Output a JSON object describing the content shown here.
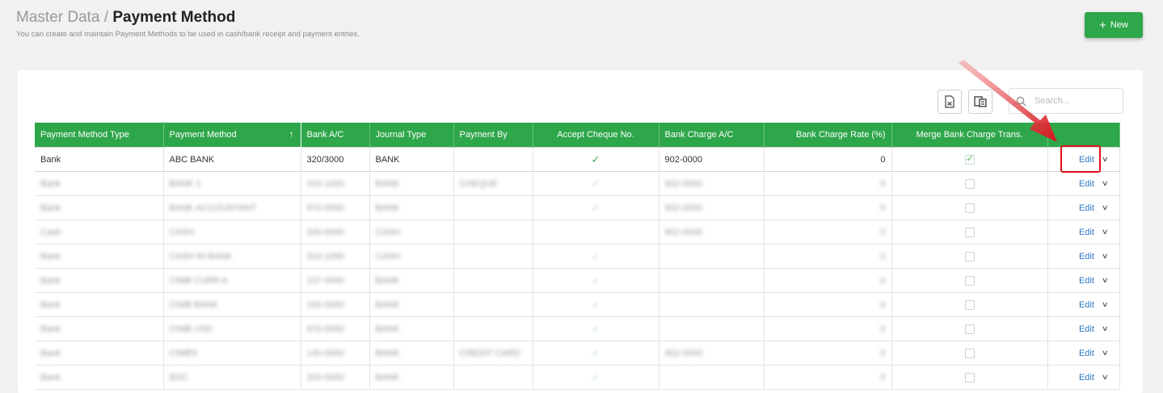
{
  "header": {
    "breadcrumb_parent": "Master Data /",
    "page_title": "Payment Method",
    "subtitle": "You can create and maintain Payment Methods to be used in cash/bank receipt and payment entries."
  },
  "toolbar": {
    "new_label": "New",
    "search_placeholder": "Search..."
  },
  "table": {
    "columns": [
      "Payment Method Type",
      "Payment Method",
      "Bank A/C",
      "Journal Type",
      "Payment By",
      "Accept Cheque No.",
      "Bank Charge A/C",
      "Bank Charge Rate (%)",
      "Merge Bank Charge Trans."
    ],
    "sorted_column": "Payment Method",
    "rows": [
      {
        "type": "Bank",
        "method": "ABC BANK",
        "bank_ac": "320/3000",
        "journal": "BANK",
        "payment_by": "",
        "accept_cheque": true,
        "charge_ac": "902-0000",
        "charge_rate": "0",
        "merge": true,
        "blurred": false
      },
      {
        "type": "Bank",
        "method": "BANK 1",
        "bank_ac": "310-1000",
        "journal": "BANK",
        "payment_by": "CHEQUE",
        "accept_cheque": true,
        "charge_ac": "902-0000",
        "charge_rate": "0",
        "merge": false,
        "blurred": true
      },
      {
        "type": "Bank",
        "method": "BANK ACCOUNTANT",
        "bank_ac": "970-0000",
        "journal": "BANK",
        "payment_by": "",
        "accept_cheque": true,
        "charge_ac": "902-0000",
        "charge_rate": "0",
        "merge": false,
        "blurred": true
      },
      {
        "type": "Cash",
        "method": "CASH",
        "bank_ac": "330-0000",
        "journal": "CASH",
        "payment_by": "",
        "accept_cheque": false,
        "charge_ac": "902-0000",
        "charge_rate": "0",
        "merge": false,
        "blurred": true
      },
      {
        "type": "Bank",
        "method": "CASH IN BANK",
        "bank_ac": "310-1000",
        "journal": "CASH",
        "payment_by": "",
        "accept_cheque": true,
        "charge_ac": "",
        "charge_rate": "0",
        "merge": false,
        "blurred": true
      },
      {
        "type": "Bank",
        "method": "CIMB CURR A",
        "bank_ac": "137-0000",
        "journal": "BANK",
        "payment_by": "",
        "accept_cheque": true,
        "charge_ac": "",
        "charge_rate": "0",
        "merge": false,
        "blurred": true
      },
      {
        "type": "Bank",
        "method": "CIMB BANK",
        "bank_ac": "100-0000",
        "journal": "BANK",
        "payment_by": "",
        "accept_cheque": true,
        "charge_ac": "",
        "charge_rate": "0",
        "merge": false,
        "blurred": true
      },
      {
        "type": "Bank",
        "method": "CIMB USD",
        "bank_ac": "970-0000",
        "journal": "BANK",
        "payment_by": "",
        "accept_cheque": true,
        "charge_ac": "",
        "charge_rate": "0",
        "merge": false,
        "blurred": true
      },
      {
        "type": "Bank",
        "method": "CIMBS",
        "bank_ac": "140-0000",
        "journal": "BANK",
        "payment_by": "CREDIT CARD",
        "accept_cheque": true,
        "charge_ac": "902-0000",
        "charge_rate": "0",
        "merge": false,
        "blurred": true
      },
      {
        "type": "Bank",
        "method": "EDC",
        "bank_ac": "320-0000",
        "journal": "BANK",
        "payment_by": "",
        "accept_cheque": true,
        "charge_ac": "",
        "charge_rate": "0",
        "merge": false,
        "blurred": true
      }
    ],
    "action_label": "Edit"
  },
  "colors": {
    "accent_green": "#2ea64a",
    "link_blue": "#2b78c5",
    "highlight_red": "#e0141c"
  }
}
